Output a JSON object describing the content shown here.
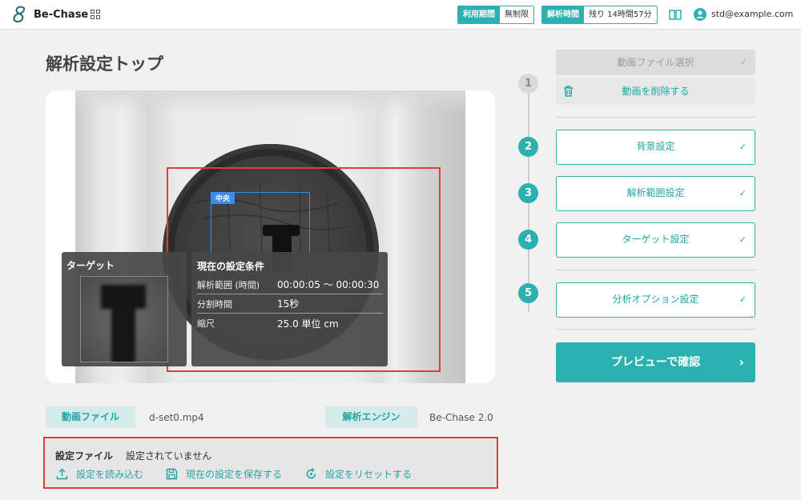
{
  "header": {
    "logo_text": "Be-Chase",
    "usage_period_label": "利用期間",
    "usage_period_value": "無制限",
    "analysis_time_label": "解析時間",
    "analysis_time_value": "残り 14時間57分",
    "user_email": "std@example.com"
  },
  "page_title": "解析設定トップ",
  "video": {
    "roi_label": "中央",
    "target_title": "ターゲット",
    "conditions": {
      "title": "現在の設定条件",
      "rows": [
        {
          "key": "解析範囲 (時間)",
          "value": "00:00:05 〜 00:00:30"
        },
        {
          "key": "分割時間",
          "value": "15秒"
        },
        {
          "key": "縮尺",
          "value": "25.0  単位  cm"
        }
      ]
    }
  },
  "info": {
    "video_file_label": "動画ファイル",
    "video_file_value": "d-set0.mp4",
    "engine_label": "解析エンジン",
    "engine_value": "Be-Chase 2.0"
  },
  "settings_file": {
    "label": "設定ファイル",
    "value": "設定されていません",
    "load": "設定を読み込む",
    "save": "現在の設定を保存する",
    "reset": "設定をリセットする"
  },
  "steps": {
    "video_select": "動画ファイル選択",
    "delete_video": "動画を削除する",
    "items": [
      {
        "num": "1"
      },
      {
        "num": "2",
        "label": "背景設定"
      },
      {
        "num": "3",
        "label": "解析範囲設定"
      },
      {
        "num": "4",
        "label": "ターゲット設定"
      },
      {
        "num": "5",
        "label": "分析オプション設定"
      }
    ],
    "check_mark": "✓",
    "preview": "プレビューで確認",
    "preview_arrow": "›"
  },
  "colors": {
    "accent": "#2bb1b0",
    "roi_red": "#e23b3b",
    "roi_blue": "#3a8ef0"
  }
}
